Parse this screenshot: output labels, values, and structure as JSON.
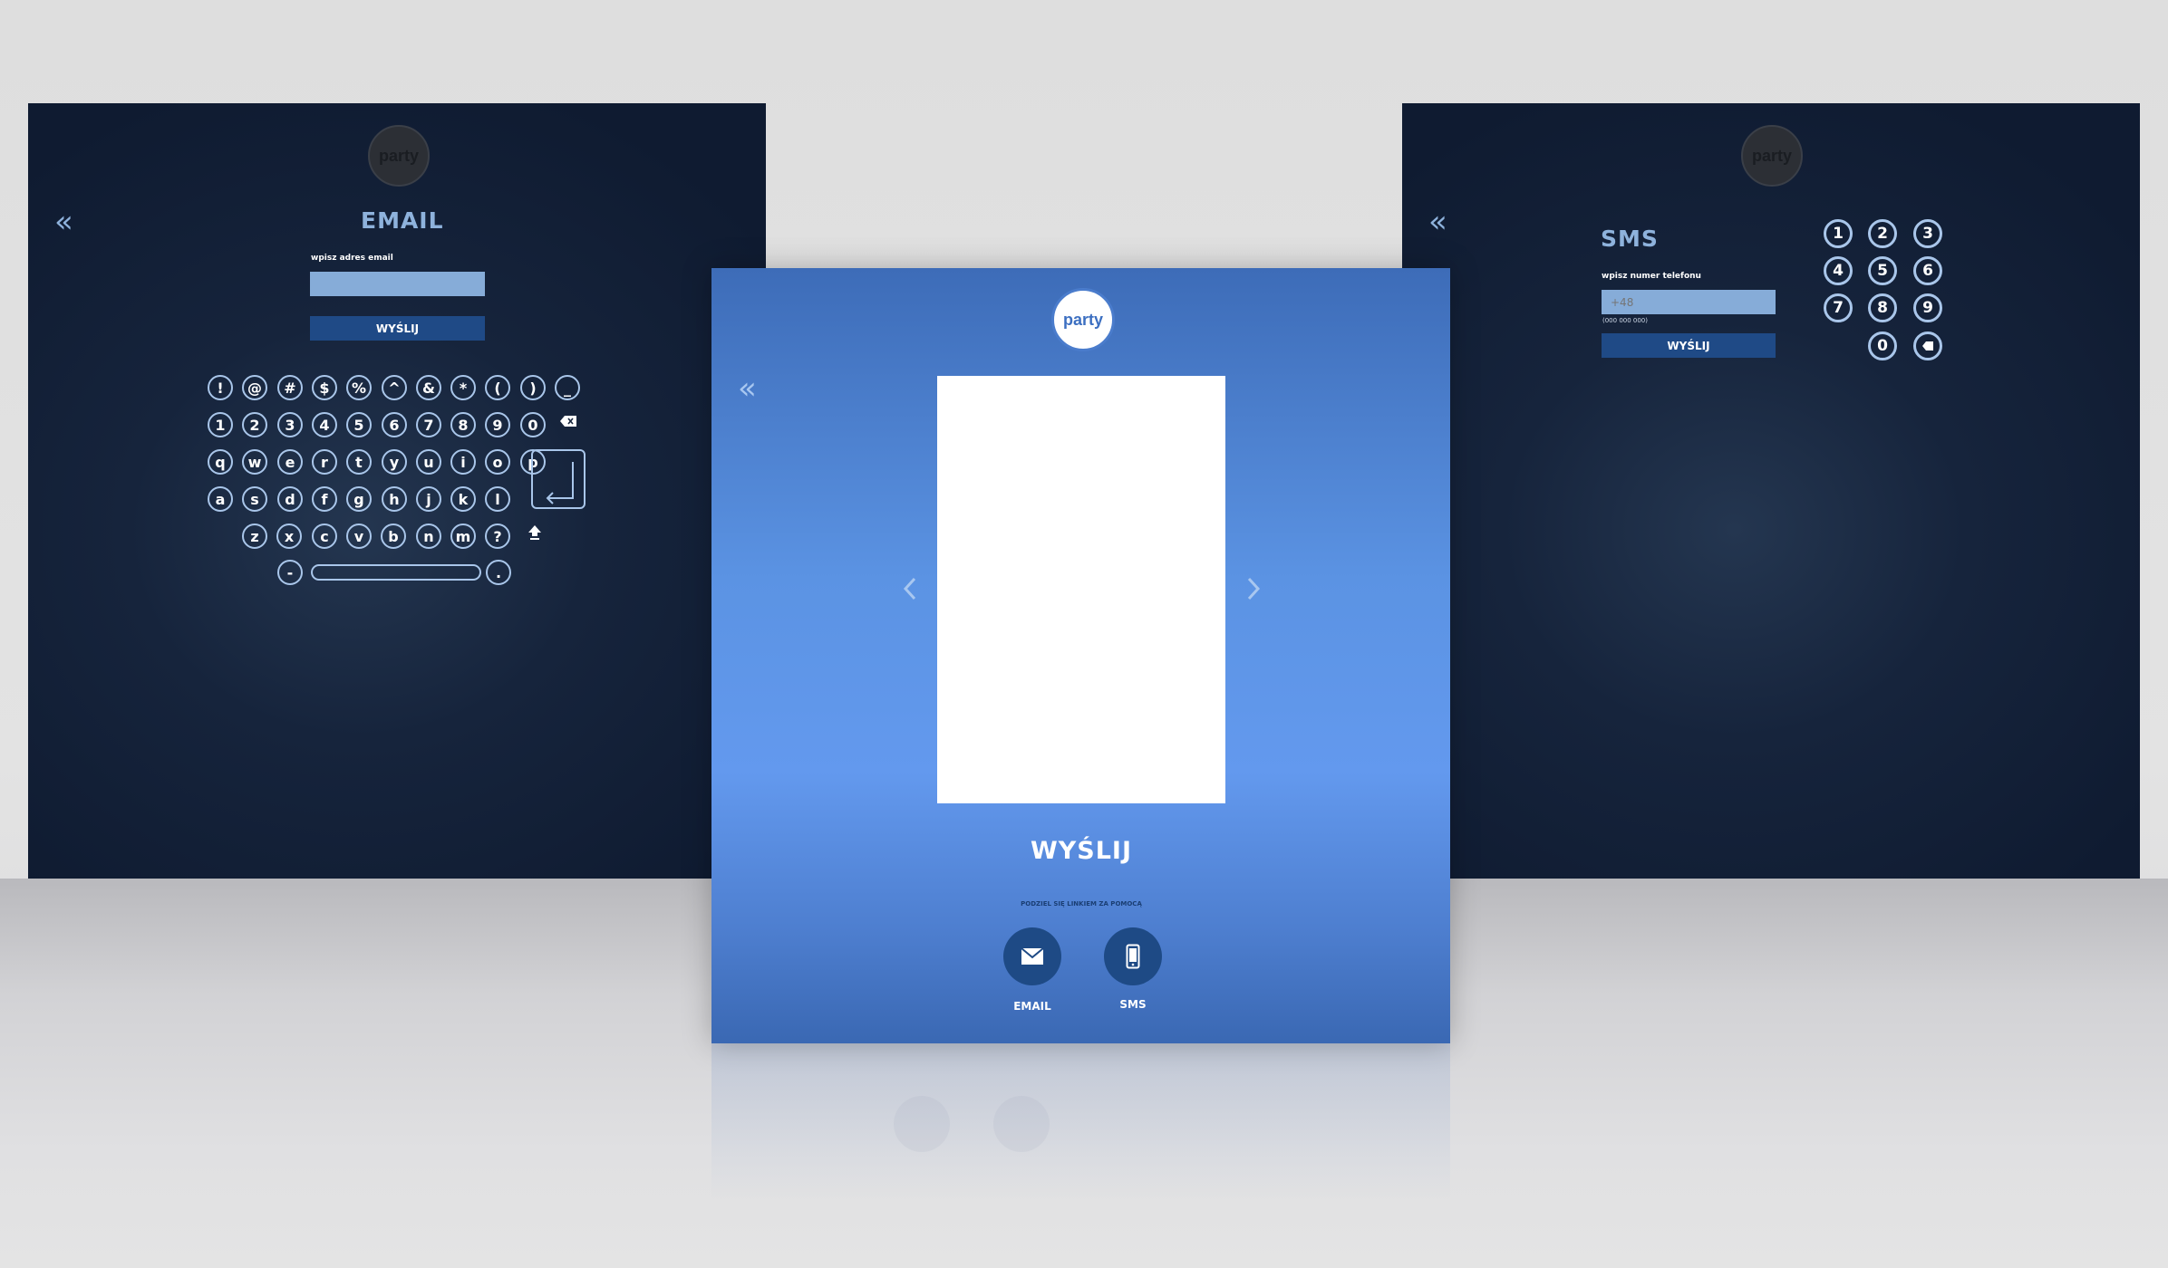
{
  "email_screen": {
    "logo_text": "party",
    "title": "EMAIL",
    "field_label": "wpisz adres email",
    "email_value": "",
    "send_label": "WYŚLIJ",
    "keyboard_rows": [
      [
        "!",
        "@",
        "#",
        "$",
        "%",
        "^",
        "&",
        "*",
        "(",
        ")",
        "_"
      ],
      [
        "1",
        "2",
        "3",
        "4",
        "5",
        "6",
        "7",
        "8",
        "9",
        "0"
      ],
      [
        "q",
        "w",
        "e",
        "r",
        "t",
        "y",
        "u",
        "i",
        "o",
        "p"
      ],
      [
        "a",
        "s",
        "d",
        "f",
        "g",
        "h",
        "j",
        "k",
        "l"
      ],
      [
        "z",
        "x",
        "c",
        "v",
        "b",
        "n",
        "m",
        "?"
      ]
    ],
    "bottom_keys": [
      "-",
      "."
    ]
  },
  "sms_screen": {
    "logo_text": "party",
    "title": "SMS",
    "field_label": "wpisz numer telefonu",
    "phone_placeholder": "+48",
    "phone_hint": "(000 000 000)",
    "send_label": "WYŚLIJ",
    "numpad": [
      "1",
      "2",
      "3",
      "4",
      "5",
      "6",
      "7",
      "8",
      "9",
      "0"
    ]
  },
  "share_screen": {
    "logo_text": "party",
    "title": "WYŚLIJ",
    "share_hint": "PODZIEL SIĘ LINKIEM ZA POMOCĄ",
    "email_label": "EMAIL",
    "sms_label": "SMS"
  },
  "icons": {
    "back": "double-chevron-left-icon",
    "prev": "chevron-left-icon",
    "next": "chevron-right-icon",
    "backspace": "backspace-icon",
    "shift": "shift-icon",
    "enter": "enter-icon",
    "mail": "envelope-icon",
    "phone": "smartphone-icon"
  },
  "colors": {
    "dark_bg": "#0f1b31",
    "accent_light": "#86acd8",
    "button_navy": "#1f4a86",
    "share_blue": "#6399ee"
  }
}
